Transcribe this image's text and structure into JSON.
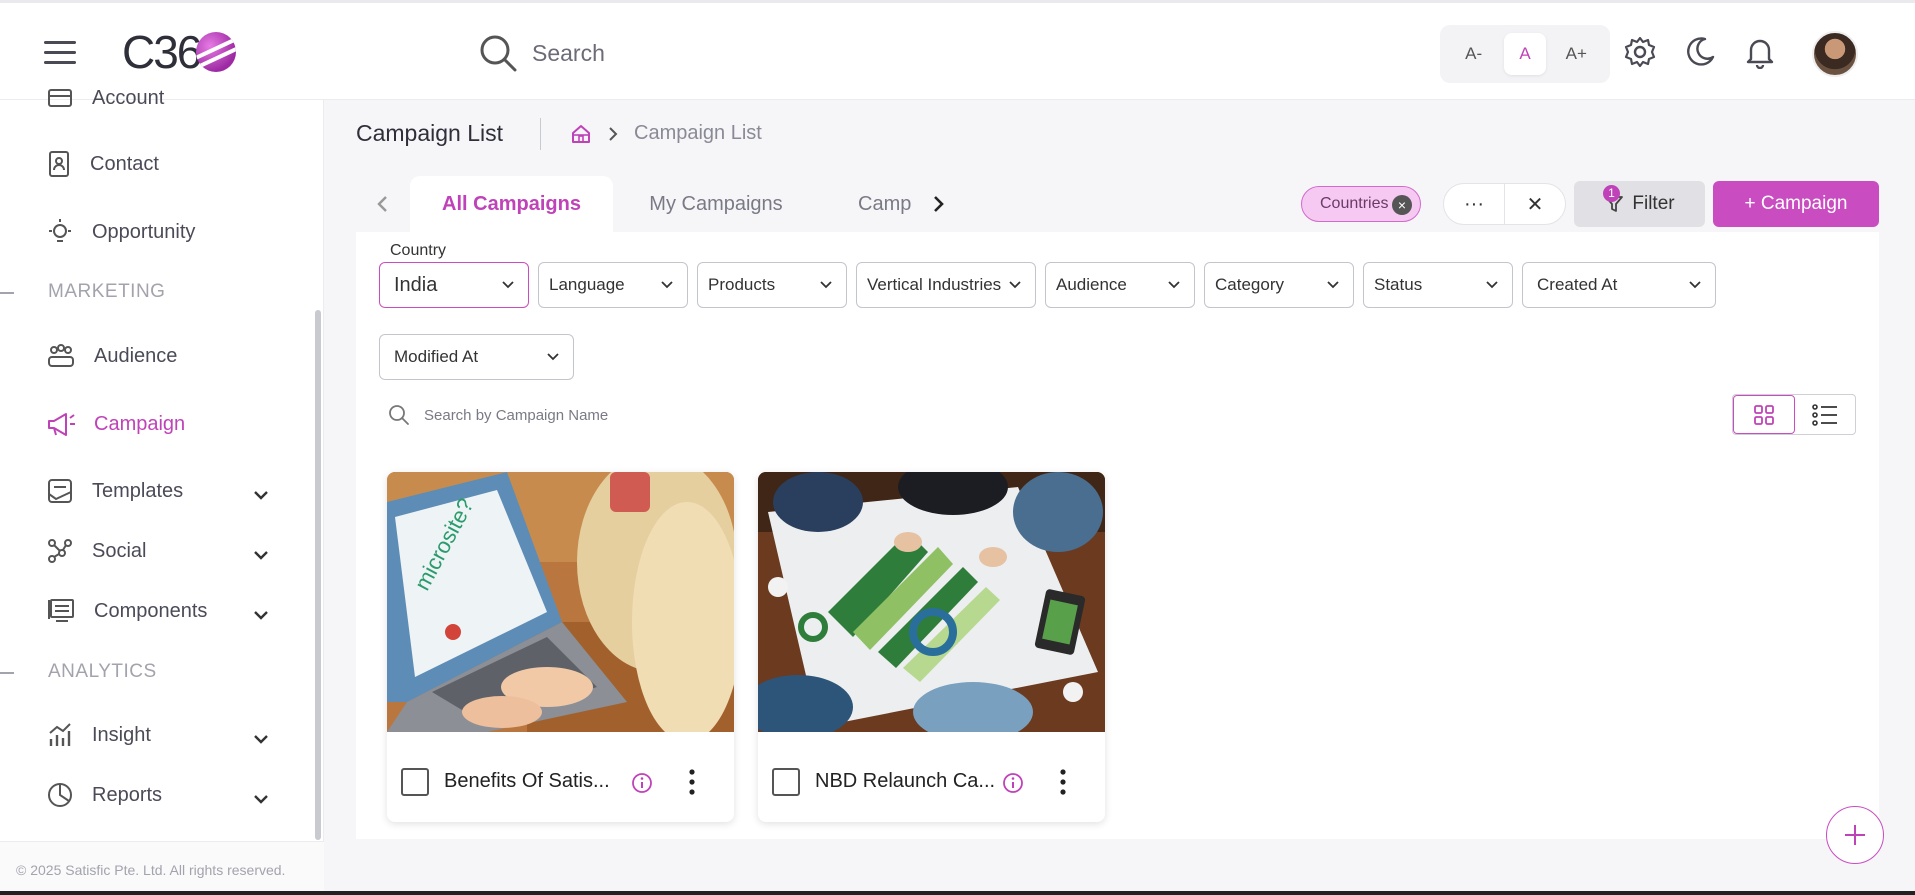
{
  "header": {
    "search_placeholder": "Search",
    "logo_text": "C36",
    "font_sizes": [
      "A-",
      "A",
      "A+"
    ],
    "active_font_size": "A"
  },
  "sidebar": {
    "items_top": [
      {
        "label": "Account",
        "icon": "account-icon"
      },
      {
        "label": "Contact",
        "icon": "contact-icon"
      },
      {
        "label": "Opportunity",
        "icon": "bulb-icon"
      }
    ],
    "section_marketing": "MARKETING",
    "marketing_items": [
      {
        "label": "Audience",
        "icon": "audience-icon"
      },
      {
        "label": "Campaign",
        "icon": "megaphone-icon",
        "active": true
      },
      {
        "label": "Templates",
        "icon": "template-icon",
        "expandable": true
      },
      {
        "label": "Social",
        "icon": "social-icon",
        "expandable": true
      },
      {
        "label": "Components",
        "icon": "components-icon",
        "expandable": true
      }
    ],
    "section_analytics": "ANALYTICS",
    "analytics_items": [
      {
        "label": "Insight",
        "icon": "chart-icon",
        "expandable": true
      },
      {
        "label": "Reports",
        "icon": "pie-icon",
        "expandable": true
      }
    ],
    "copyright": "© 2025 Satisfic Pte. Ltd. All rights reserved."
  },
  "page": {
    "title": "Campaign List",
    "breadcrumb_current": "Campaign List"
  },
  "tabs": [
    {
      "label": "All Campaigns",
      "active": true
    },
    {
      "label": "My Campaigns",
      "active": false
    },
    {
      "label": "Camp",
      "active": false
    }
  ],
  "toolbar": {
    "chip_label": "Countries",
    "more_label": "···",
    "clear_label": "✕",
    "filter_label": "Filter",
    "filter_count": "1",
    "campaign_button": "+ Campaign"
  },
  "filters": {
    "country_label": "Country",
    "country_value": "India",
    "dropdowns": [
      "Language",
      "Products",
      "Vertical Industries",
      "Audience",
      "Category",
      "Status",
      "Created At",
      "Modified At"
    ]
  },
  "search": {
    "placeholder": "Search by Campaign Name"
  },
  "cards": [
    {
      "title": "Benefits Of Satis..."
    },
    {
      "title": "NBD Relaunch Ca..."
    }
  ],
  "colors": {
    "accent": "#c94dc1",
    "chip_bg": "#f6c9f2"
  }
}
